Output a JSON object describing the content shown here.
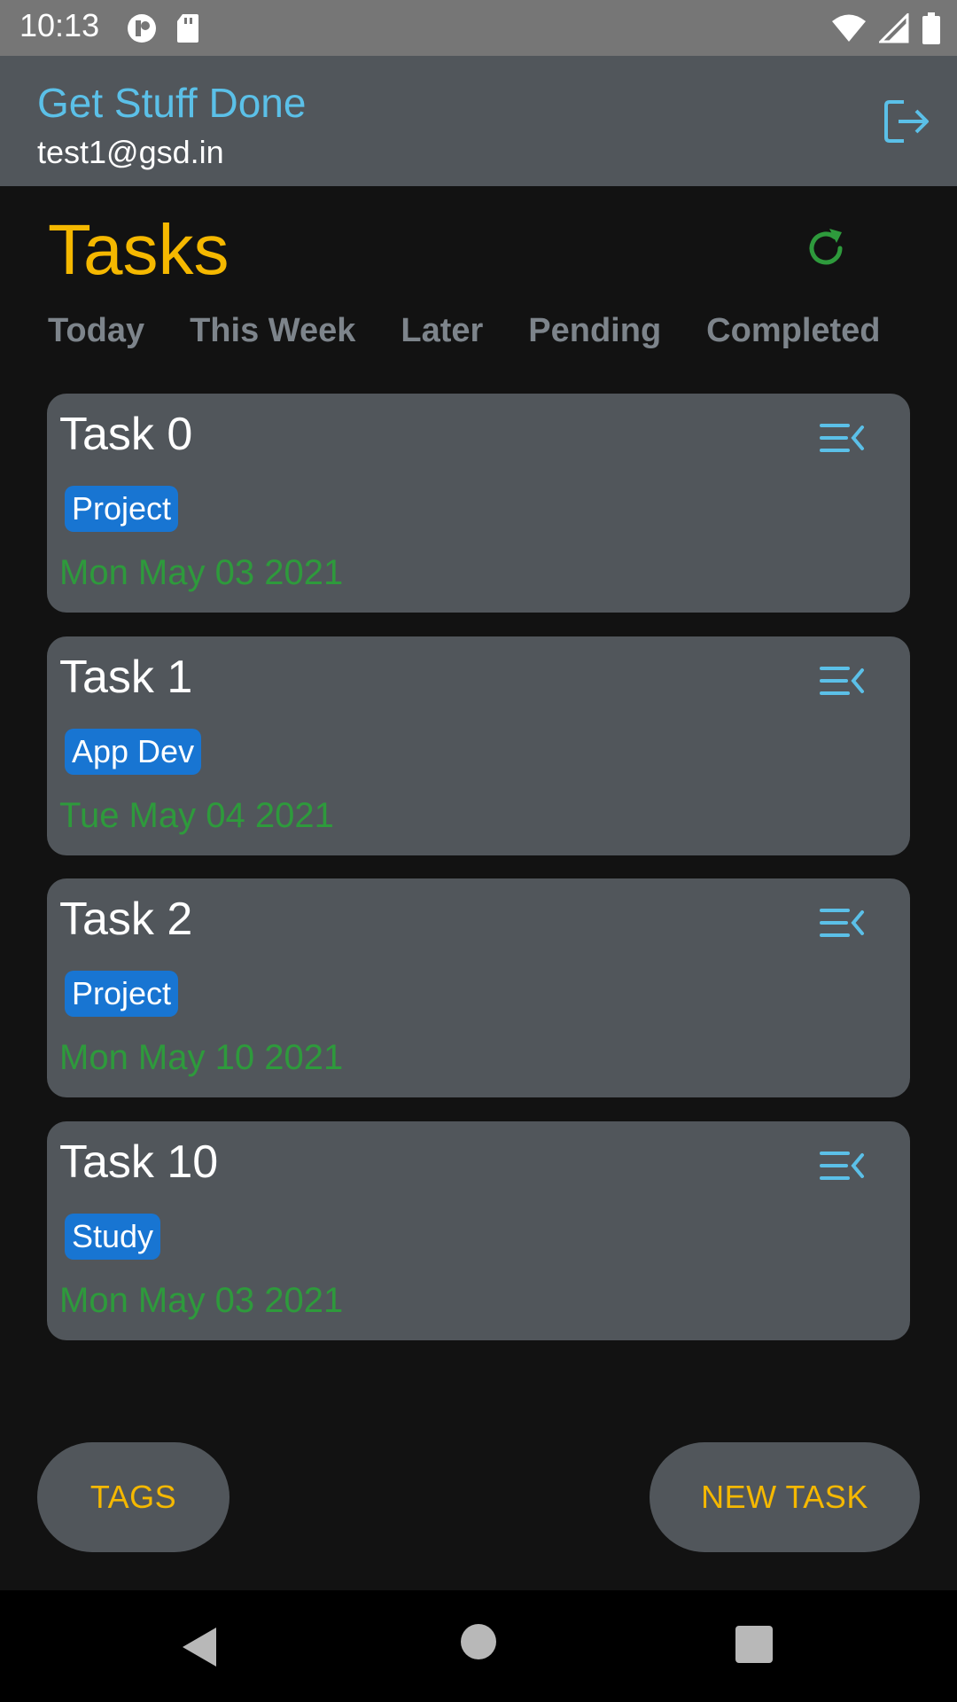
{
  "status_bar": {
    "time": "10:13",
    "icons": [
      "notification-icon",
      "sd-card-icon",
      "wifi-icon",
      "signal-icon",
      "battery-icon"
    ]
  },
  "app": {
    "title": "Get Stuff Done",
    "email": "test1@gsd.in",
    "logout_icon": "logout-icon"
  },
  "page": {
    "title": "Tasks",
    "refresh_icon": "refresh-icon"
  },
  "tabs": [
    {
      "label": "Today"
    },
    {
      "label": "This Week"
    },
    {
      "label": "Later"
    },
    {
      "label": "Pending"
    },
    {
      "label": "Completed"
    }
  ],
  "tasks": [
    {
      "title": "Task 0",
      "tag": "Project",
      "date": "Mon May 03 2021"
    },
    {
      "title": "Task 1",
      "tag": "App Dev",
      "date": "Tue May 04 2021"
    },
    {
      "title": "Task 2",
      "tag": "Project",
      "date": "Mon May 10 2021"
    },
    {
      "title": "Task 10",
      "tag": "Study",
      "date": "Mon May 03 2021"
    }
  ],
  "buttons": {
    "tags": "TAGS",
    "new_task": "NEW TASK"
  },
  "colors": {
    "accent_yellow": "#f5b800",
    "accent_blue": "#5bc0e8",
    "date_green": "#2e9a3c",
    "tag_blue": "#1875d2",
    "card_bg": "#51565b",
    "page_bg": "#121212"
  }
}
